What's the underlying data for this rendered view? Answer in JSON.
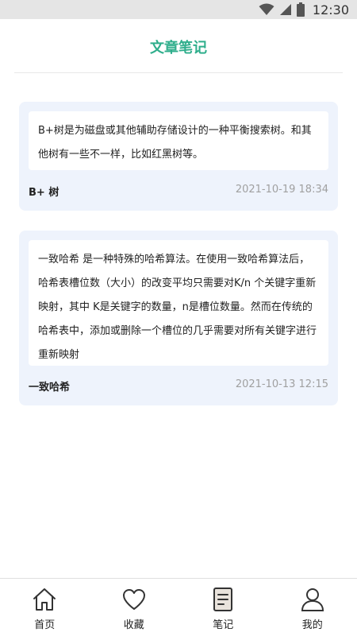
{
  "status_bar": {
    "time": "12:30"
  },
  "header": {
    "title": "文章笔记"
  },
  "notes": [
    {
      "content": "B+树是为磁盘或其他辅助存储设计的一种平衡搜索树。和其他树有一些不一样，比如红黑树等。",
      "title": "B+ 树",
      "time": "2021-10-19 18:34"
    },
    {
      "content": "一致哈希 是一种特殊的哈希算法。在使用一致哈希算法后，哈希表槽位数（大小）的改变平均只需要对K/n 个关键字重新映射，其中 K是关键字的数量，n是槽位数量。然而在传统的哈希表中，添加或删除一个槽位的几乎需要对所有关键字进行重新映射",
      "title": "一致哈希",
      "time": "2021-10-13 12:15"
    }
  ],
  "tab_bar": {
    "items": [
      {
        "label": "首页",
        "icon": "home-icon"
      },
      {
        "label": "收藏",
        "icon": "heart-icon"
      },
      {
        "label": "笔记",
        "icon": "note-icon"
      },
      {
        "label": "我的",
        "icon": "user-icon"
      }
    ]
  },
  "colors": {
    "accent": "#2fae8c",
    "card_background": "#eef3fc",
    "timestamp": "#a0a0a0"
  }
}
